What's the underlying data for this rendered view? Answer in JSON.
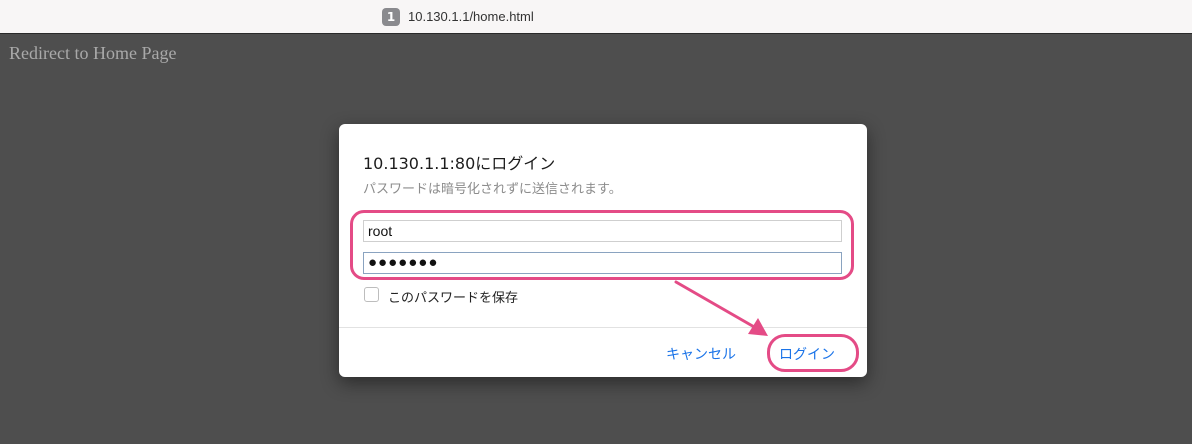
{
  "browser": {
    "tab_number": "1",
    "url": "10.130.1.1/home.html"
  },
  "page": {
    "redirect_text": "Redirect to Home Page"
  },
  "dialog": {
    "title": "10.130.1.1:80にログイン",
    "subtitle": "パスワードは暗号化されずに送信されます。",
    "username_value": "root",
    "password_value": "●●●●●●●",
    "save_password_label": "このパスワードを保存",
    "save_password_checked": false,
    "cancel_label": "キャンセル",
    "login_label": "ログイン"
  },
  "colors": {
    "page_background": "#4e4e4e",
    "annotation": "#e44b86",
    "button_text": "#1a73e8"
  }
}
